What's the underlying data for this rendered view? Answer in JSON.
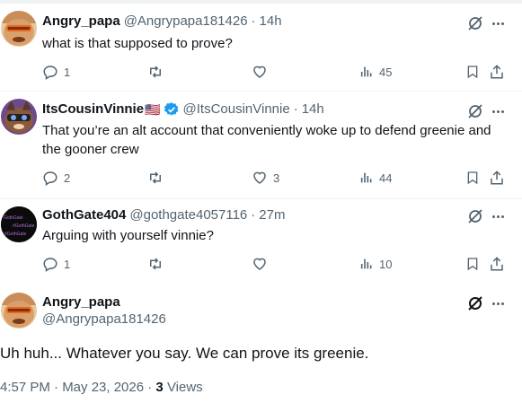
{
  "colors": {
    "text": "#0f1419",
    "secondary": "#536471",
    "verified": "#1d9bf0",
    "divider": "#eff3f4"
  },
  "replies": [
    {
      "name": "Angry_papa",
      "handle": "@Angrypapa181426",
      "sep": "·",
      "time": "14h",
      "text": "what is that supposed to prove?",
      "counts": {
        "replies": "1",
        "reposts": "",
        "likes": "",
        "views": "45"
      },
      "icons": [
        "reply-icon",
        "repost-icon",
        "like-icon",
        "views-icon",
        "bookmark-icon",
        "share-icon"
      ]
    },
    {
      "name": "ItsCousinVinnie",
      "flag": "🇺🇸",
      "handle": "@ItsCousinVinnie",
      "sep": "·",
      "time": "14h",
      "text": "That you’re an alt account that conveniently woke up to defend greenie and the gooner crew",
      "counts": {
        "replies": "2",
        "reposts": "",
        "likes": "3",
        "views": "44"
      }
    },
    {
      "name": "GothGate404",
      "handle": "@gothgate4057116",
      "sep": "·",
      "time": "27m",
      "text": "Arguing with yourself vinnie?",
      "avatar_text": [
        "GothGate",
        "#GothGate",
        "#GothGate"
      ],
      "counts": {
        "replies": "1",
        "reposts": "",
        "likes": "",
        "views": "10"
      }
    }
  ],
  "main_post": {
    "name": "Angry_papa",
    "handle": "@Angrypapa181426",
    "text": "Uh huh... Whatever you say.  We can prove its greenie.",
    "time": "4:57 PM · May 23, 2026 ·",
    "views_count": "3",
    "views_label": "Views"
  }
}
